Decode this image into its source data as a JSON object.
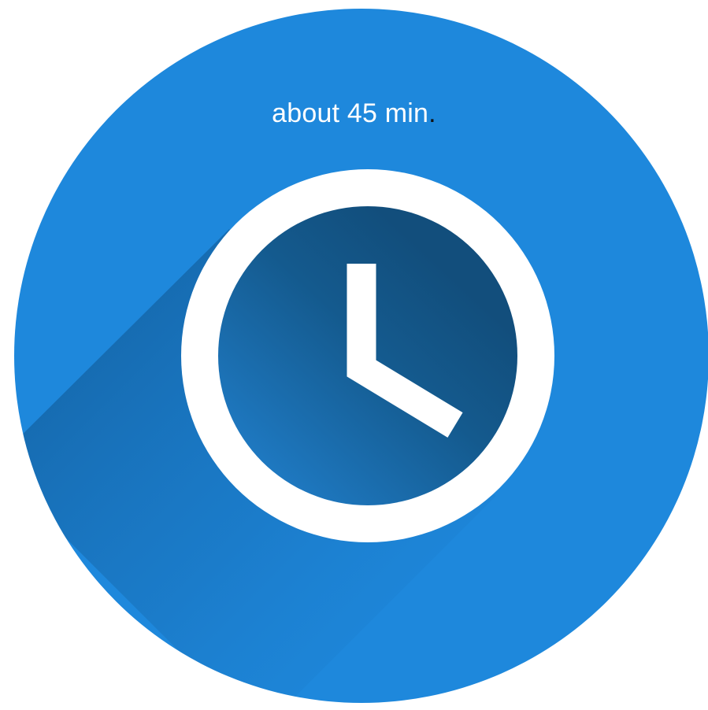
{
  "duration": {
    "text": "about 45 min",
    "period": "."
  },
  "icon": {
    "name": "clock-icon",
    "hands": {
      "hour": 4,
      "minute": 0
    }
  },
  "colors": {
    "circle_background": "#1e88dc",
    "clock_face": "#145a8e",
    "clock_face_light": "#1e78c0",
    "ring_and_hands": "#ffffff",
    "long_shadow": "#0f5a96",
    "label_text": "#ffffff",
    "label_period": "#111111"
  }
}
